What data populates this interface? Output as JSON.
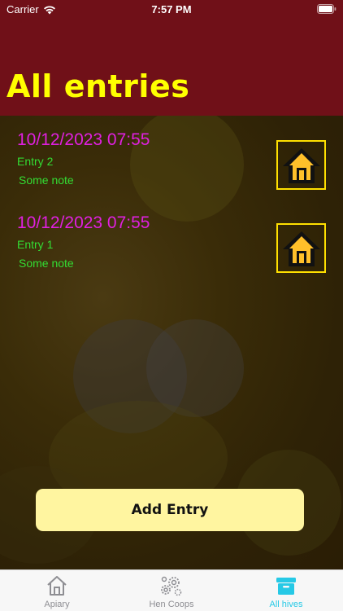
{
  "status_bar": {
    "carrier": "Carrier",
    "time": "7:57 PM"
  },
  "header": {
    "title": "All entries"
  },
  "entries": [
    {
      "date": "10/12/2023 07:55",
      "title": "Entry 2",
      "note": "Some note",
      "icon": "house-icon"
    },
    {
      "date": "10/12/2023 07:55",
      "title": "Entry 1",
      "note": "Some note",
      "icon": "house-icon"
    }
  ],
  "actions": {
    "add_entry_label": "Add Entry"
  },
  "tab_bar": {
    "tabs": [
      {
        "label": "Apiary",
        "icon": "house-outline-icon",
        "active": false
      },
      {
        "label": "Hen Coops",
        "icon": "gear-cluster-icon",
        "active": false
      },
      {
        "label": "All hives",
        "icon": "archive-box-icon",
        "active": true
      }
    ]
  },
  "colors": {
    "header_bg": "#701018",
    "title": "#ffff00",
    "date": "#e020e0",
    "entry_text": "#33dd33",
    "icon_border": "#ffe000",
    "button_bg": "#fff5a0",
    "active_tab": "#26c9e6"
  }
}
